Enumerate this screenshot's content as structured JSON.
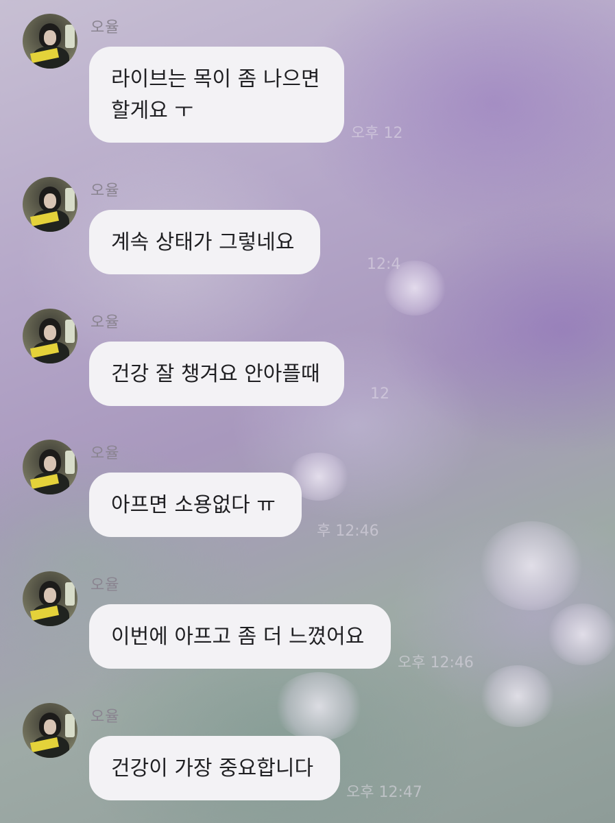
{
  "chat": {
    "sender": "오율",
    "messages": [
      {
        "line1": "라이브는 목이 좀 나으면",
        "line2": "할게요 ㅜ",
        "time": "오후 12"
      },
      {
        "line1": "계속 상태가 그렇네요",
        "time": "12:4"
      },
      {
        "line1": "건강 잘 챙겨요 안아플때",
        "time": "12"
      },
      {
        "line1": "아프면 소용없다 ㅠ",
        "time": "후 12:46"
      },
      {
        "line1": "이번에 아프고 좀 더 느꼈어요",
        "time": "오후 12:46"
      },
      {
        "line1": "건강이 가장 중요합니다",
        "time": "오후 12:47"
      }
    ]
  },
  "colors": {
    "bubble": "#f3f2f5",
    "text": "#1f1f22",
    "name": "#8a8490"
  }
}
